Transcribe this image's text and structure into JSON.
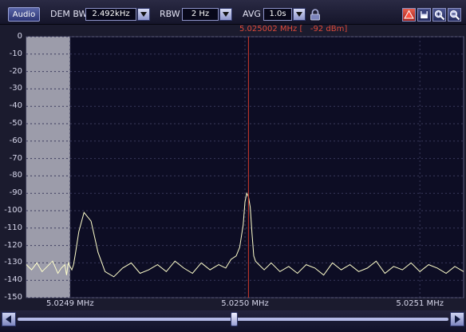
{
  "toolbar": {
    "audio_label": "Audio",
    "dem_bw_label": "DEM BW",
    "dem_bw_value": "2.492kHz",
    "rbw_label": "RBW",
    "rbw_value": "2 Hz",
    "avg_label": "AVG",
    "avg_value": "1.0s",
    "icons": [
      "dropdown-arrow-icon",
      "lock-icon",
      "peak-marker-icon",
      "save-icon",
      "zoom-in-icon",
      "zoom-out-icon"
    ]
  },
  "marker": {
    "readout": "5.025002 MHz [   -92 dBm]",
    "frequency_mhz": 5.025002,
    "level_dbm": -92
  },
  "chart_data": {
    "type": "line",
    "title": "",
    "xlabel": "",
    "ylabel": "",
    "xlim": [
      5.024875,
      5.025125
    ],
    "ylim": [
      -150,
      0
    ],
    "grid": true,
    "y_ticks": [
      "0",
      "-10",
      "-20",
      "-30",
      "-40",
      "-50",
      "-60",
      "-70",
      "-80",
      "-90",
      "-100",
      "-110",
      "-120",
      "-130",
      "-140",
      "-150"
    ],
    "x_ticks": [
      {
        "value": 5.0249,
        "label": "5.0249 MHz"
      },
      {
        "value": 5.025,
        "label": "5.0250 MHz"
      },
      {
        "value": 5.0251,
        "label": "5.0251 MHz"
      }
    ],
    "demod_band": [
      5.024875,
      5.0249
    ],
    "series": [
      {
        "color": "#ffffcc",
        "x": [
          5.024875,
          5.024878,
          5.024881,
          5.024884,
          5.024887,
          5.02489,
          5.024893,
          5.024895,
          5.024897,
          5.024898,
          5.024899,
          5.0249,
          5.024901,
          5.024902,
          5.024903,
          5.024905,
          5.024908,
          5.024912,
          5.024916,
          5.02492,
          5.024925,
          5.02493,
          5.024935,
          5.02494,
          5.024945,
          5.02495,
          5.024955,
          5.02496,
          5.024965,
          5.02497,
          5.024975,
          5.02498,
          5.024985,
          5.024989,
          5.024992,
          5.024995,
          5.024997,
          5.024999,
          5.025,
          5.025001,
          5.025002,
          5.025003,
          5.025004,
          5.025005,
          5.025006,
          5.025008,
          5.025011,
          5.025015,
          5.02502,
          5.025025,
          5.02503,
          5.025035,
          5.02504,
          5.025045,
          5.02505,
          5.025055,
          5.02506,
          5.025065,
          5.02507,
          5.025075,
          5.02508,
          5.025085,
          5.02509,
          5.025095,
          5.0251,
          5.025105,
          5.02511,
          5.025115,
          5.02512,
          5.025125
        ],
        "y": [
          -131,
          -134,
          -130,
          -135,
          -132,
          -129,
          -136,
          -133,
          -131,
          -137,
          -130,
          -132,
          -134,
          -131,
          -125,
          -112,
          -101,
          -106,
          -124,
          -135,
          -138,
          -133,
          -130,
          -136,
          -134,
          -131,
          -135,
          -129,
          -133,
          -136,
          -130,
          -134,
          -131,
          -133,
          -128,
          -126,
          -121,
          -108,
          -95,
          -90,
          -92,
          -98,
          -113,
          -126,
          -129,
          -131,
          -134,
          -130,
          -135,
          -132,
          -136,
          -131,
          -133,
          -137,
          -130,
          -134,
          -131,
          -135,
          -133,
          -129,
          -136,
          -132,
          -134,
          -130,
          -135,
          -131,
          -133,
          -136,
          -132,
          -135
        ]
      }
    ]
  }
}
